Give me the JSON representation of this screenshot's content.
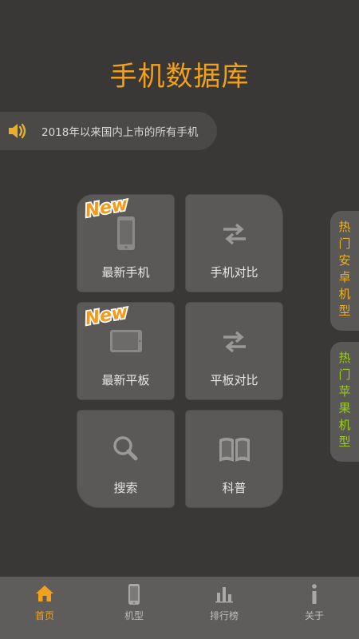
{
  "app": {
    "title": "手机数据库"
  },
  "announcement": {
    "icon": "speaker-icon",
    "text": "2018年以来国内上市的所有手机"
  },
  "badges": {
    "new": "New"
  },
  "tiles": [
    {
      "label": "最新手机",
      "icon": "phone-icon",
      "badge": "New"
    },
    {
      "label": "手机对比",
      "icon": "swap-arrows-icon"
    },
    {
      "label": "最新平板",
      "icon": "tablet-icon",
      "badge": "New"
    },
    {
      "label": "平板对比",
      "icon": "swap-arrows-icon"
    },
    {
      "label": "搜索",
      "icon": "search-icon"
    },
    {
      "label": "科普",
      "icon": "book-icon"
    }
  ],
  "side_tabs": [
    {
      "label": "热门安卓机型",
      "chars": [
        "热",
        "门",
        "安",
        "卓",
        "机",
        "型"
      ],
      "color": "#e8b028"
    },
    {
      "label": "热门苹果机型",
      "chars": [
        "热",
        "门",
        "苹",
        "果",
        "机",
        "型"
      ],
      "color": "#9ccb1f"
    }
  ],
  "tabbar": {
    "active": 0,
    "items": [
      {
        "label": "首页",
        "icon": "home-icon"
      },
      {
        "label": "机型",
        "icon": "phone-icon"
      },
      {
        "label": "排行榜",
        "icon": "bar-chart-icon"
      },
      {
        "label": "关于",
        "icon": "info-icon"
      }
    ]
  },
  "colors": {
    "background": "#393837",
    "accent": "#f2a11d",
    "tile": "#5a5958",
    "tabbar": "#5e5d5c",
    "android_label": "#e8b028",
    "apple_label": "#9ccb1f"
  }
}
